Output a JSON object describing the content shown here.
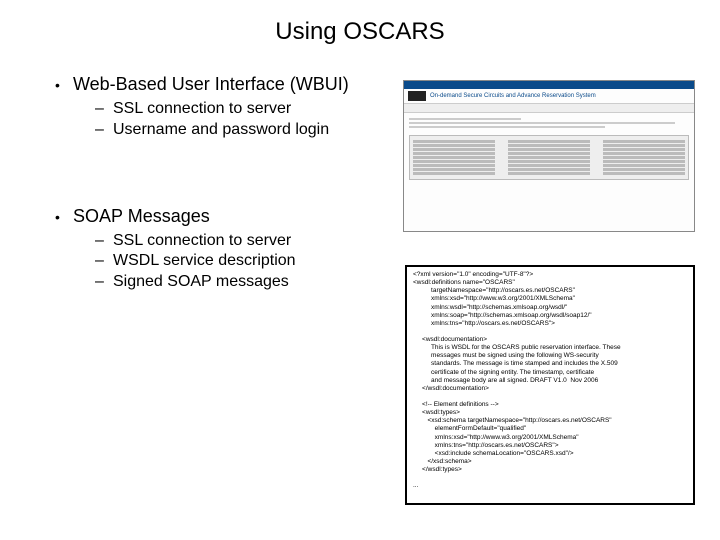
{
  "title": "Using OSCARS",
  "section1": {
    "heading": "Web-Based User Interface (WBUI)",
    "items": [
      "SSL connection to server",
      "Username and password login"
    ]
  },
  "section2": {
    "heading": "SOAP Messages",
    "items": [
      "SSL connection to server",
      "WSDL service description",
      "Signed SOAP messages"
    ]
  },
  "screenshot_title": "On-demand Secure Circuits and Advance Reservation System",
  "code": "<?xml version=\"1.0\" encoding=\"UTF-8\"?>\n<wsdl:definitions name=\"OSCARS\"\n          targetNamespace=\"http://oscars.es.net/OSCARS\"\n          xmlns:xsd=\"http://www.w3.org/2001/XMLSchema\"\n          xmlns:wsdl=\"http://schemas.xmlsoap.org/wsdl/\"\n          xmlns:soap=\"http://schemas.xmlsoap.org/wsdl/soap12/\"\n          xmlns:tns=\"http://oscars.es.net/OSCARS\">\n\n     <wsdl:documentation>\n          This is WSDL for the OSCARS public reservation interface. These\n          messages must be signed using the following WS-security\n          standards. The message is time stamped and includes the X.509\n          certificate of the signing entity. The timestamp, certificate\n          and message body are all signed. DRAFT V1.0  Nov 2006\n     </wsdl:documentation>\n\n     <!-- Element definitions -->\n     <wsdl:types>\n        <xsd:schema targetNamespace=\"http://oscars.es.net/OSCARS\"\n            elementFormDefault=\"qualified\"\n            xmlns:xsd=\"http://www.w3.org/2001/XMLSchema\"\n            xmlns:tns=\"http://oscars.es.net/OSCARS\">\n            <xsd:include schemaLocation=\"OSCARS.xsd\"/>\n        </xsd:schema>\n     </wsdl:types>\n\n..."
}
